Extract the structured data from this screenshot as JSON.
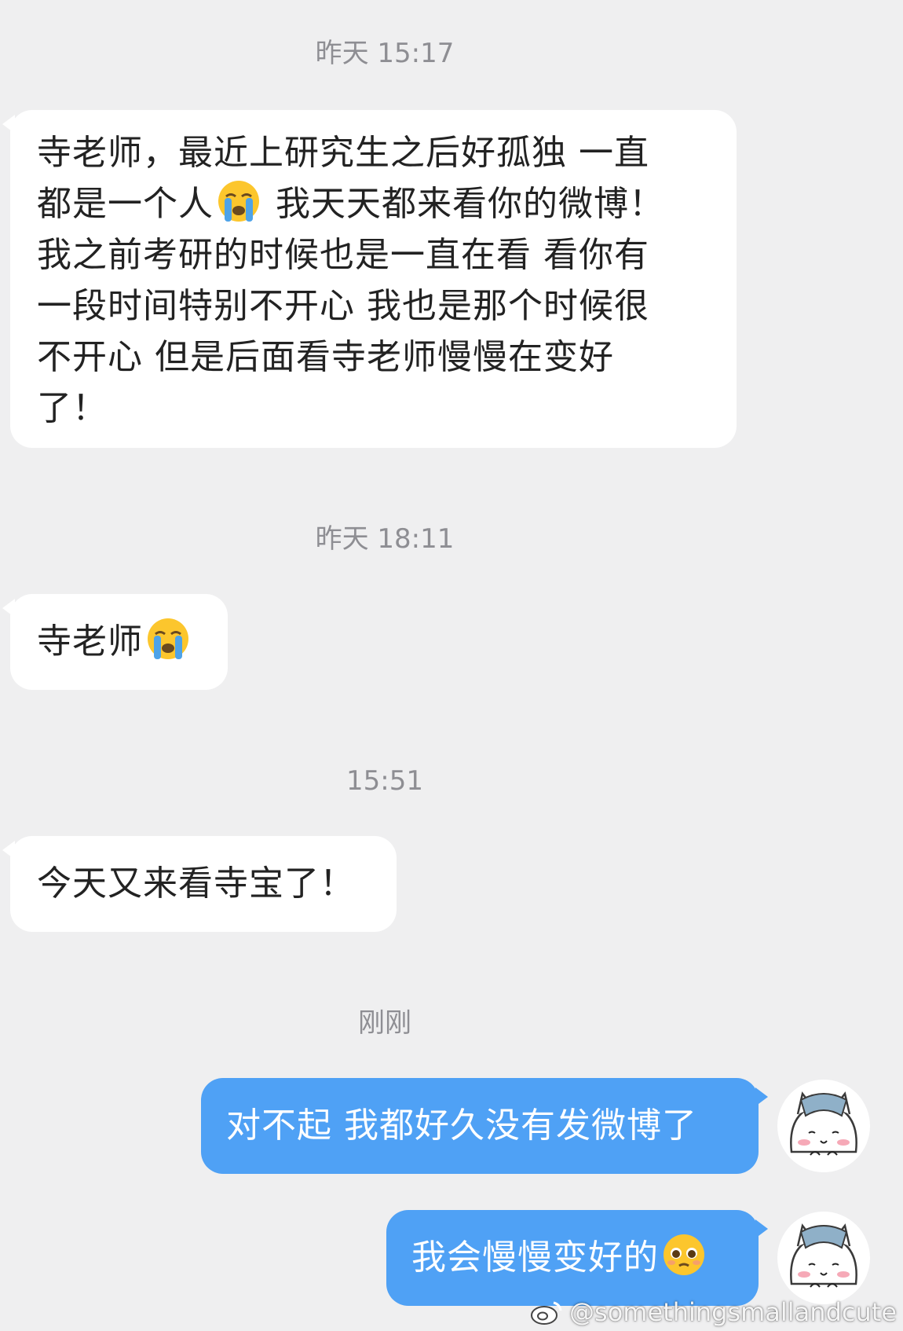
{
  "messages": [
    {
      "timestamp": "昨天 15:17",
      "text_a": "寺老师，最近上研究生之后好孤独 一直",
      "text_b": "都是一个人",
      "emoji_1": "loudly-crying-face",
      "text_c": " 我天天都来看你的微博！",
      "text_d": "我之前考研的时候也是一直在看 看你有",
      "text_e": "一段时间特别不开心 我也是那个时候很",
      "text_f": "不开心 但是后面看寺老师慢慢在变好",
      "text_g": "了！"
    },
    {
      "timestamp": "昨天 18:11",
      "text": "寺老师",
      "emoji": "loudly-crying-face"
    },
    {
      "timestamp": "15:51",
      "text": "今天又来看寺宝了！"
    },
    {
      "timestamp": "刚刚",
      "text": "对不起 我都好久没有发微博了"
    },
    {
      "text": "我会慢慢变好的",
      "emoji": "pleading-face"
    }
  ],
  "watermark": {
    "text": "@somethingsmallandcute",
    "icon": "weibo-icon"
  },
  "colors": {
    "background": "#efeff0",
    "incoming_bubble": "#ffffff",
    "outgoing_bubble": "#4fa1f5",
    "timestamp": "#8e8e93"
  }
}
